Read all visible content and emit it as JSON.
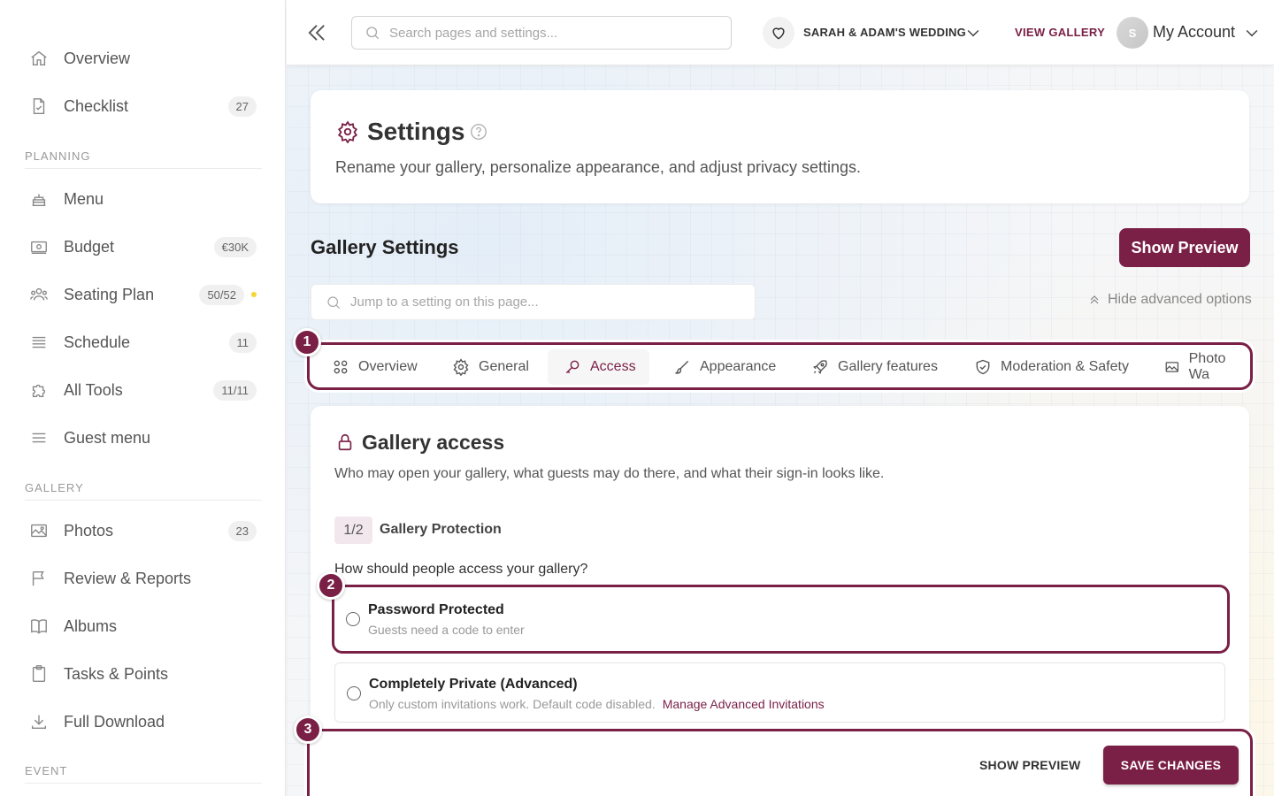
{
  "sidebar": {
    "items": [
      {
        "label": "Overview",
        "icon": "home-icon"
      },
      {
        "label": "Checklist",
        "icon": "checklist-icon",
        "badge": "27"
      }
    ],
    "sections": [
      {
        "title": "PLANNING"
      },
      {
        "title": "GALLERY"
      },
      {
        "title": "EVENT"
      }
    ],
    "planning": [
      {
        "label": "Menu",
        "icon": "cake-icon"
      },
      {
        "label": "Budget",
        "icon": "money-icon",
        "badge": "€30K"
      },
      {
        "label": "Seating Plan",
        "icon": "people-icon",
        "badge": "50/52",
        "dot_color": "#f4d534"
      },
      {
        "label": "Schedule",
        "icon": "schedule-icon",
        "badge": "11"
      },
      {
        "label": "All Tools",
        "icon": "puzzle-icon",
        "badge": "11/11"
      },
      {
        "label": "Guest menu",
        "icon": "menu-lines-icon"
      }
    ],
    "gallery": [
      {
        "label": "Photos",
        "icon": "image-icon",
        "badge": "23"
      },
      {
        "label": "Review & Reports",
        "icon": "flag-icon"
      },
      {
        "label": "Albums",
        "icon": "book-icon"
      },
      {
        "label": "Tasks & Points",
        "icon": "clipboard-icon"
      },
      {
        "label": "Full Download",
        "icon": "download-icon"
      }
    ]
  },
  "topbar": {
    "search_placeholder": "Search pages and settings...",
    "wedding_name": "SARAH & ADAM'S WEDDING",
    "view_gallery": "VIEW GALLERY",
    "avatar_initial": "S",
    "account_label": "My Account"
  },
  "header": {
    "title": "Settings",
    "subtitle": "Rename your gallery, personalize appearance, and adjust privacy settings."
  },
  "gallery_settings": {
    "title": "Gallery Settings",
    "show_preview": "Show Preview",
    "jump_placeholder": "Jump to a setting on this page...",
    "hide_advanced": "Hide advanced options"
  },
  "tabs": [
    {
      "label": "Overview",
      "icon": "grid-icon"
    },
    {
      "label": "General",
      "icon": "gear-icon"
    },
    {
      "label": "Access",
      "icon": "key-icon",
      "active": true
    },
    {
      "label": "Appearance",
      "icon": "brush-icon"
    },
    {
      "label": "Gallery features",
      "icon": "rocket-icon"
    },
    {
      "label": "Moderation & Safety",
      "icon": "shield-check-icon"
    },
    {
      "label": "Photo Wa",
      "icon": "photo-icon"
    }
  ],
  "markers": [
    "1",
    "2",
    "3"
  ],
  "access": {
    "title": "Gallery access",
    "subtitle": "Who may open your gallery, what guests may do there, and what their sign-in looks like.",
    "step": "1/2",
    "step_title": "Gallery Protection",
    "question": "How should people access your gallery?",
    "options": [
      {
        "title": "Password Protected",
        "desc": "Guests need a code to enter"
      },
      {
        "title": "Completely Private (Advanced)",
        "desc": "Only custom invitations work. Default code disabled.",
        "link": "Manage Advanced Invitations"
      }
    ]
  },
  "footer": {
    "show_preview": "SHOW PREVIEW",
    "save": "SAVE CHANGES"
  },
  "colors": {
    "accent": "#7a1f45",
    "dot": "#f4d534"
  }
}
